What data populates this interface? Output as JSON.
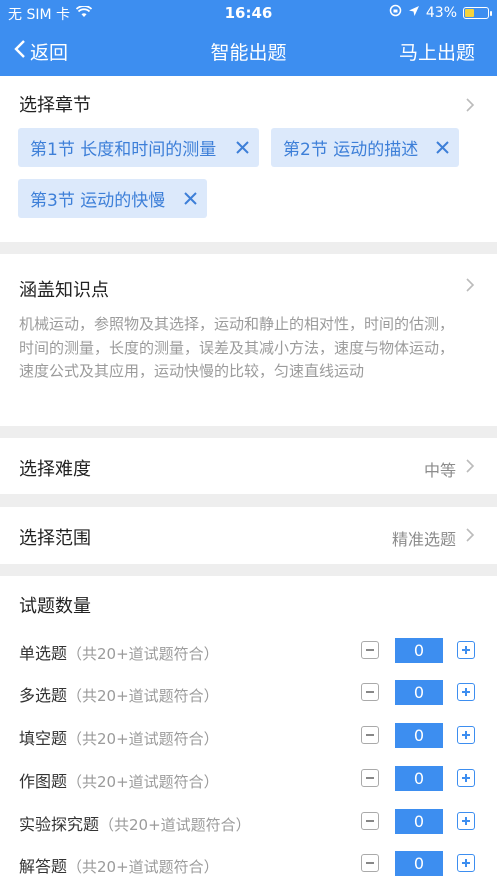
{
  "status_bar": {
    "carrier": "无 SIM 卡",
    "time": "16:46",
    "battery": "43%",
    "battery_level": 0.43
  },
  "nav": {
    "back_label": "返回",
    "title": "智能出题",
    "action_label": "马上出题"
  },
  "chapters": {
    "title": "选择章节",
    "tags": [
      "第1节  长度和时间的测量",
      "第2节  运动的描述",
      "第3节  运动的快慢"
    ]
  },
  "knowledge": {
    "title": "涵盖知识点",
    "text": "机械运动，参照物及其选择，运动和静止的相对性，时间的估测，时间的测量，长度的测量，误差及其减小方法，速度与物体运动，速度公式及其应用，运动快慢的比较，匀速直线运动"
  },
  "difficulty": {
    "title": "选择难度",
    "value": "中等"
  },
  "scope": {
    "title": "选择范围",
    "value": "精准选题"
  },
  "quantity": {
    "title": "试题数量",
    "rows": [
      {
        "label": "单选题",
        "note": "（共20+道试题符合）",
        "value": "0"
      },
      {
        "label": "多选题",
        "note": "（共20+道试题符合）",
        "value": "0"
      },
      {
        "label": "填空题",
        "note": "（共20+道试题符合）",
        "value": "0"
      },
      {
        "label": "作图题",
        "note": "（共20+道试题符合）",
        "value": "0"
      },
      {
        "label": "实验探究题",
        "note": "（共20+道试题符合）",
        "value": "0"
      },
      {
        "label": "解答题",
        "note": "（共20+道试题符合）",
        "value": "0"
      }
    ]
  },
  "colors": {
    "accent": "#3d8ef0",
    "tag_bg": "#dce9fb",
    "tag_text": "#3d7fd8"
  }
}
